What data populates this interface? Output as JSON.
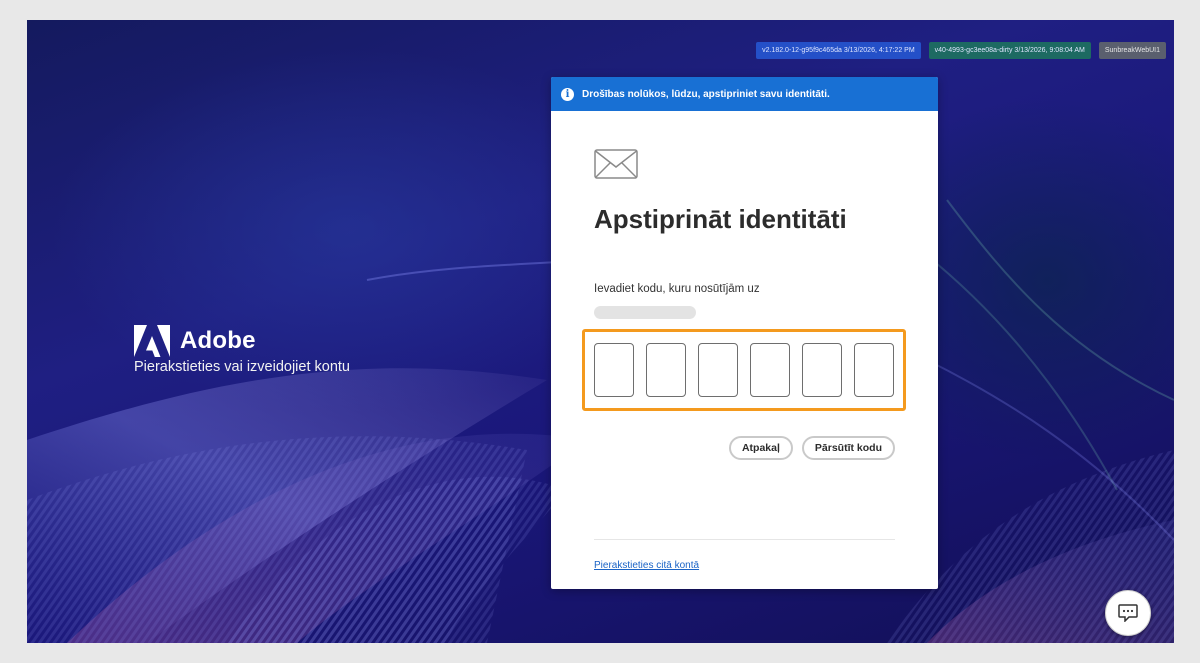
{
  "build_badges": [
    {
      "text": "v2.182.0-12-g95f9c465da 3/13/2026, 4:17:22 PM",
      "color": "#2450c8"
    },
    {
      "text": "v40-4993-gc3ee08a-dirty 3/13/2026, 9:08:04 AM",
      "color": "#1d6a62"
    },
    {
      "text": "SunbreakWebUI1",
      "color": "#5a5f6e"
    }
  ],
  "brand": {
    "name": "Adobe",
    "tagline": "Pierakstieties vai izveidojiet kontu",
    "logo_icon": "adobe-logo-icon"
  },
  "dialog": {
    "info_icon": "info-icon",
    "info_message": "Drošības nolūkos, lūdzu, apstipriniet savu identitāti.",
    "mail_icon": "envelope-icon",
    "title": "Apstiprināt identitāti",
    "subtitle": "Ievadiet kodu, kuru nosūtījām uz",
    "code_digits": [
      "",
      "",
      "",
      "",
      "",
      ""
    ],
    "back_label": "Atpakaļ",
    "resend_label": "Pārsūtīt kodu",
    "other_account_link": "Pierakstieties citā kontā",
    "accent_color": "#1870d4",
    "highlight_color": "#f49a1e"
  },
  "chat": {
    "icon": "chat-icon"
  }
}
